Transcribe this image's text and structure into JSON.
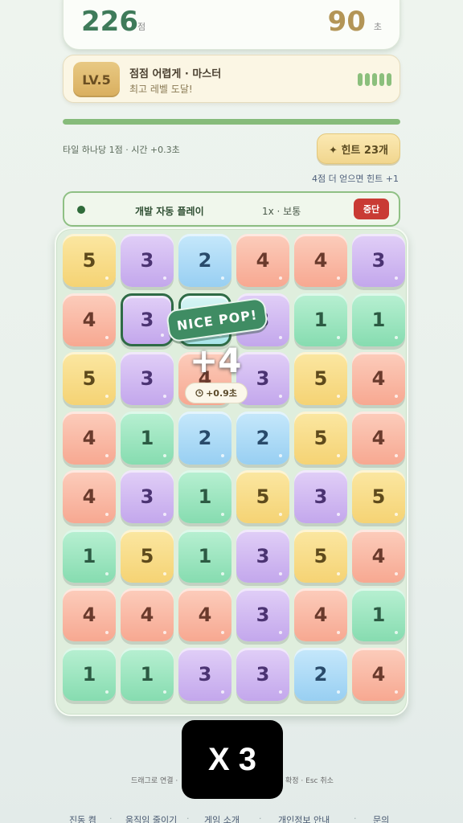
{
  "score": {
    "points": "226",
    "points_unit": "점",
    "time": "90",
    "time_unit": "초"
  },
  "level": {
    "badge": "LV.5",
    "title": "점점 어렵게 · 마스터",
    "subtitle": "최고 레벨 도달!",
    "pips_filled": 5,
    "pips_total": 5
  },
  "progress": {
    "fraction": 1.0
  },
  "rules": {
    "text": "타일 하나당 1점 · 시간 +0.3초",
    "hint_label": "✦ 힌트 23개",
    "hint_sub": "4점 더 얻으면 힌트 +1"
  },
  "autoplay": {
    "title": "개발 자동 플레이",
    "speed": "1x · 보통",
    "stop_label": "중단"
  },
  "board": {
    "rows": [
      [
        5,
        3,
        2,
        4,
        4,
        3
      ],
      [
        4,
        3,
        0,
        3,
        1,
        1
      ],
      [
        5,
        3,
        4,
        3,
        5,
        4
      ],
      [
        4,
        1,
        2,
        2,
        5,
        4
      ],
      [
        4,
        3,
        1,
        5,
        3,
        5
      ],
      [
        1,
        5,
        1,
        3,
        5,
        4
      ],
      [
        4,
        4,
        4,
        3,
        4,
        1
      ],
      [
        1,
        1,
        3,
        3,
        2,
        4
      ]
    ],
    "selected": [
      [
        1,
        1
      ],
      [
        1,
        2
      ]
    ]
  },
  "popup": {
    "banner": "NICE POP!",
    "points": "+4",
    "time_bonus": "+0.9초",
    "clock_icon": "clock-icon"
  },
  "overlay": {
    "multiplier": "X 3"
  },
  "help": {
    "left": "드래그로 연결 ·",
    "right": "확정 · Esc 취소"
  },
  "footer": {
    "items": [
      "진동 켬",
      "움직임 줄이기",
      "게임 소개",
      "개인정보 안내",
      "문의"
    ],
    "separator": "·"
  }
}
